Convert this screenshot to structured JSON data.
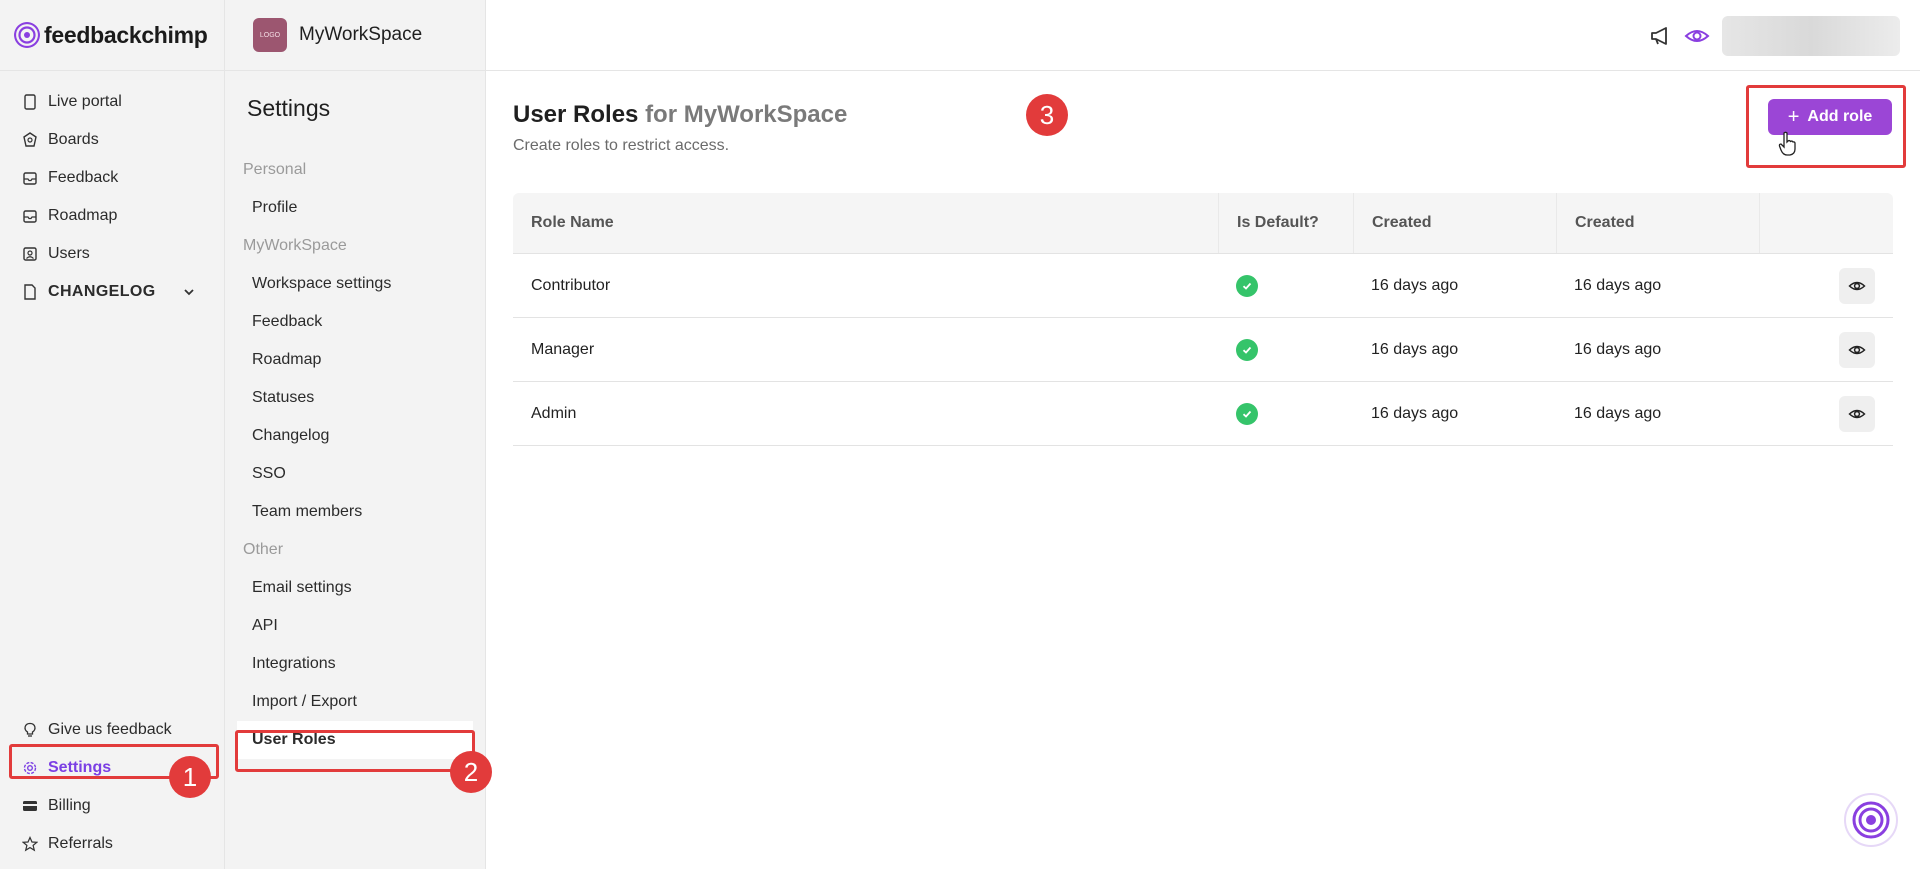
{
  "brand": {
    "name": "feedbackchimp"
  },
  "sidebar": {
    "items": [
      {
        "label": "Live portal",
        "icon": "tablet-icon"
      },
      {
        "label": "Boards",
        "icon": "boards-icon"
      },
      {
        "label": "Feedback",
        "icon": "inbox-icon"
      },
      {
        "label": "Roadmap",
        "icon": "roadmap-icon"
      },
      {
        "label": "Users",
        "icon": "users-icon"
      },
      {
        "label": "CHANGELOG",
        "icon": "changelog-icon"
      }
    ],
    "bottom_items": [
      {
        "label": "Give us feedback",
        "icon": "lightbulb-icon"
      },
      {
        "label": "Settings",
        "icon": "gear-icon"
      },
      {
        "label": "Billing",
        "icon": "card-icon"
      },
      {
        "label": "Referrals",
        "icon": "star-icon"
      }
    ]
  },
  "workspace": {
    "name": "MyWorkSpace",
    "logo_text": "LOGO"
  },
  "settings": {
    "title": "Settings",
    "personal_label": "Personal",
    "personal_items": [
      "Profile"
    ],
    "workspace_label": "MyWorkSpace",
    "workspace_items": [
      "Workspace settings",
      "Feedback",
      "Roadmap",
      "Statuses",
      "Changelog",
      "SSO",
      "Team members"
    ],
    "other_label": "Other",
    "other_items": [
      "Email settings",
      "API",
      "Integrations",
      "Import / Export",
      "User Roles"
    ]
  },
  "page": {
    "title": "User Roles",
    "title_suffix": "for MyWorkSpace",
    "subtitle": "Create roles to restrict access.",
    "add_button": "Add role"
  },
  "table": {
    "headers": [
      "Role Name",
      "Is Default?",
      "Created",
      "Created"
    ],
    "rows": [
      {
        "name": "Contributor",
        "created": "16 days ago",
        "updated": "16 days ago"
      },
      {
        "name": "Manager",
        "created": "16 days ago",
        "updated": "16 days ago"
      },
      {
        "name": "Admin",
        "created": "16 days ago",
        "updated": "16 days ago"
      }
    ]
  },
  "annotations": {
    "badge1": "1",
    "badge2": "2",
    "badge3": "3"
  },
  "colors": {
    "accent": "#9b46d6",
    "highlight": "#e23b3b",
    "check": "#35c46a"
  }
}
